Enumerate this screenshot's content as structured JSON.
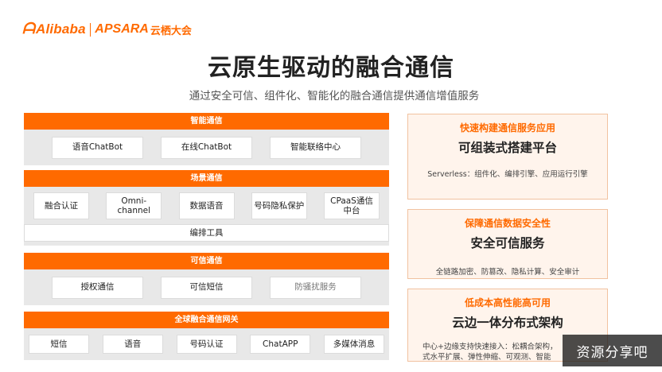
{
  "brand": {
    "alibaba": "Alibaba",
    "apsara": "APSARA",
    "yunqi": "云栖大会"
  },
  "title": "云原生驱动的融合通信",
  "subtitle": "通过安全可信、组件化、智能化的融合通信提供通信增值服务",
  "sections": {
    "smart": {
      "title": "智能通信",
      "items": [
        "语音ChatBot",
        "在线ChatBot",
        "智能联络中心"
      ]
    },
    "scene": {
      "title": "场景通信",
      "items": [
        "融合认证",
        "Omni-\nchannel",
        "数据语音",
        "号码隐私保护",
        "CPaaS通信\n中台"
      ],
      "orchestration": "编排工具"
    },
    "trusted": {
      "title": "可信通信",
      "items": [
        "授权通信",
        "可信短信",
        "防骚扰服务"
      ]
    },
    "gateway": {
      "title": "全球融合通信网关",
      "items": [
        "短信",
        "语音",
        "号码认证",
        "ChatAPP",
        "多媒体消息"
      ]
    }
  },
  "right_cards": [
    {
      "head": "快速构建通信服务应用",
      "main": "可组装式搭建平台",
      "desc": "Serverless：组件化、编排引擎、应用运行引擎"
    },
    {
      "head": "保障通信数据安全性",
      "main": "安全可信服务",
      "desc": "全链路加密、防篡改、隐私计算、安全审计"
    },
    {
      "head": "低成本高性能高可用",
      "main": "云边一体分布式架构",
      "desc": "中心+边缘支持快速接入：松耦合架构，\n式水平扩展、弹性伸缩、可观测、智能"
    }
  ],
  "watermark": "资源分享吧",
  "colors": {
    "accent": "#ff6a00",
    "panel_grey": "#e8e8e8",
    "card_bg": "#fff4ec"
  }
}
